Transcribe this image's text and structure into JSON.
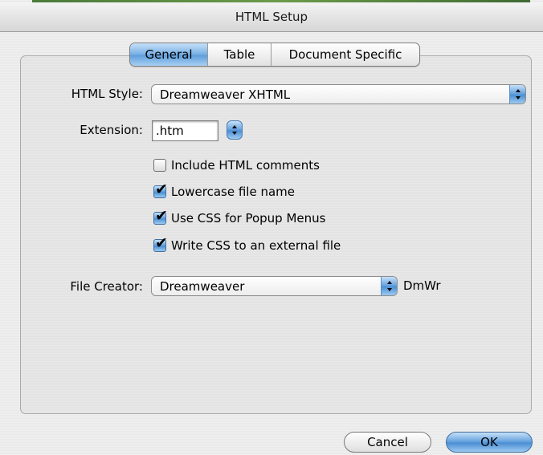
{
  "window": {
    "title": "HTML Setup"
  },
  "tabs": [
    {
      "label": "General",
      "selected": true
    },
    {
      "label": "Table",
      "selected": false
    },
    {
      "label": "Document Specific",
      "selected": false
    }
  ],
  "form": {
    "html_style_label": "HTML Style:",
    "html_style_value": "Dreamweaver XHTML",
    "extension_label": "Extension:",
    "extension_value": ".htm",
    "options": [
      {
        "label": "Include HTML comments",
        "checked": false
      },
      {
        "label": "Lowercase file name",
        "checked": true
      },
      {
        "label": "Use CSS for Popup Menus",
        "checked": true
      },
      {
        "label": "Write CSS to an external file",
        "checked": true
      }
    ],
    "file_creator_label": "File Creator:",
    "file_creator_value": "Dreamweaver",
    "file_creator_code": "DmWr"
  },
  "buttons": {
    "cancel": "Cancel",
    "ok": "OK"
  },
  "colors": {
    "aqua_blue": "#5f9fdc",
    "window_bg": "#ececec"
  },
  "icons": {
    "checkmark": "checkmark-icon",
    "stepper": "popup-stepper-icon"
  }
}
